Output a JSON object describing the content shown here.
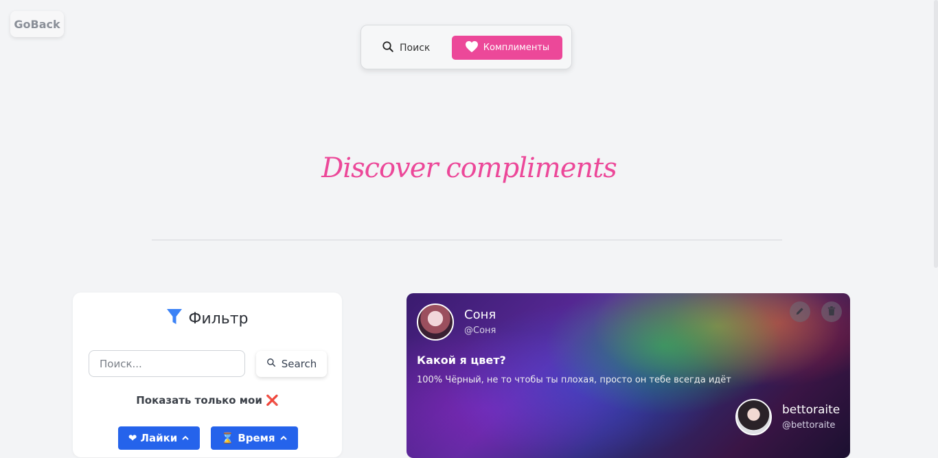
{
  "goback": {
    "label": "GoBack"
  },
  "nav": {
    "search_label": "Поиск",
    "compliments_label": "Комплименты",
    "active": "compliments"
  },
  "hero": {
    "title": "Discover compliments"
  },
  "filter": {
    "title": "Фильтр",
    "search_placeholder": "Поиск...",
    "search_button": "Search",
    "only_mine_label": "Показать только мои ❌",
    "sort_likes": "❤ Лайки",
    "sort_time": "⌛ Время"
  },
  "card": {
    "author_name": "Соня",
    "author_handle": "@Соня",
    "title": "Какой я цвет?",
    "text": "100% Чёрный, не то чтобы ты плохая, просто он тебе всегда идёт",
    "target_name": "bettoraite",
    "target_handle": "@bettoraite"
  },
  "colors": {
    "accent": "#ec4899",
    "primary": "#2563eb"
  },
  "icons": [
    "search-icon",
    "heart-icon",
    "filter-icon",
    "chevron-up-icon",
    "pencil-icon",
    "trash-icon"
  ]
}
